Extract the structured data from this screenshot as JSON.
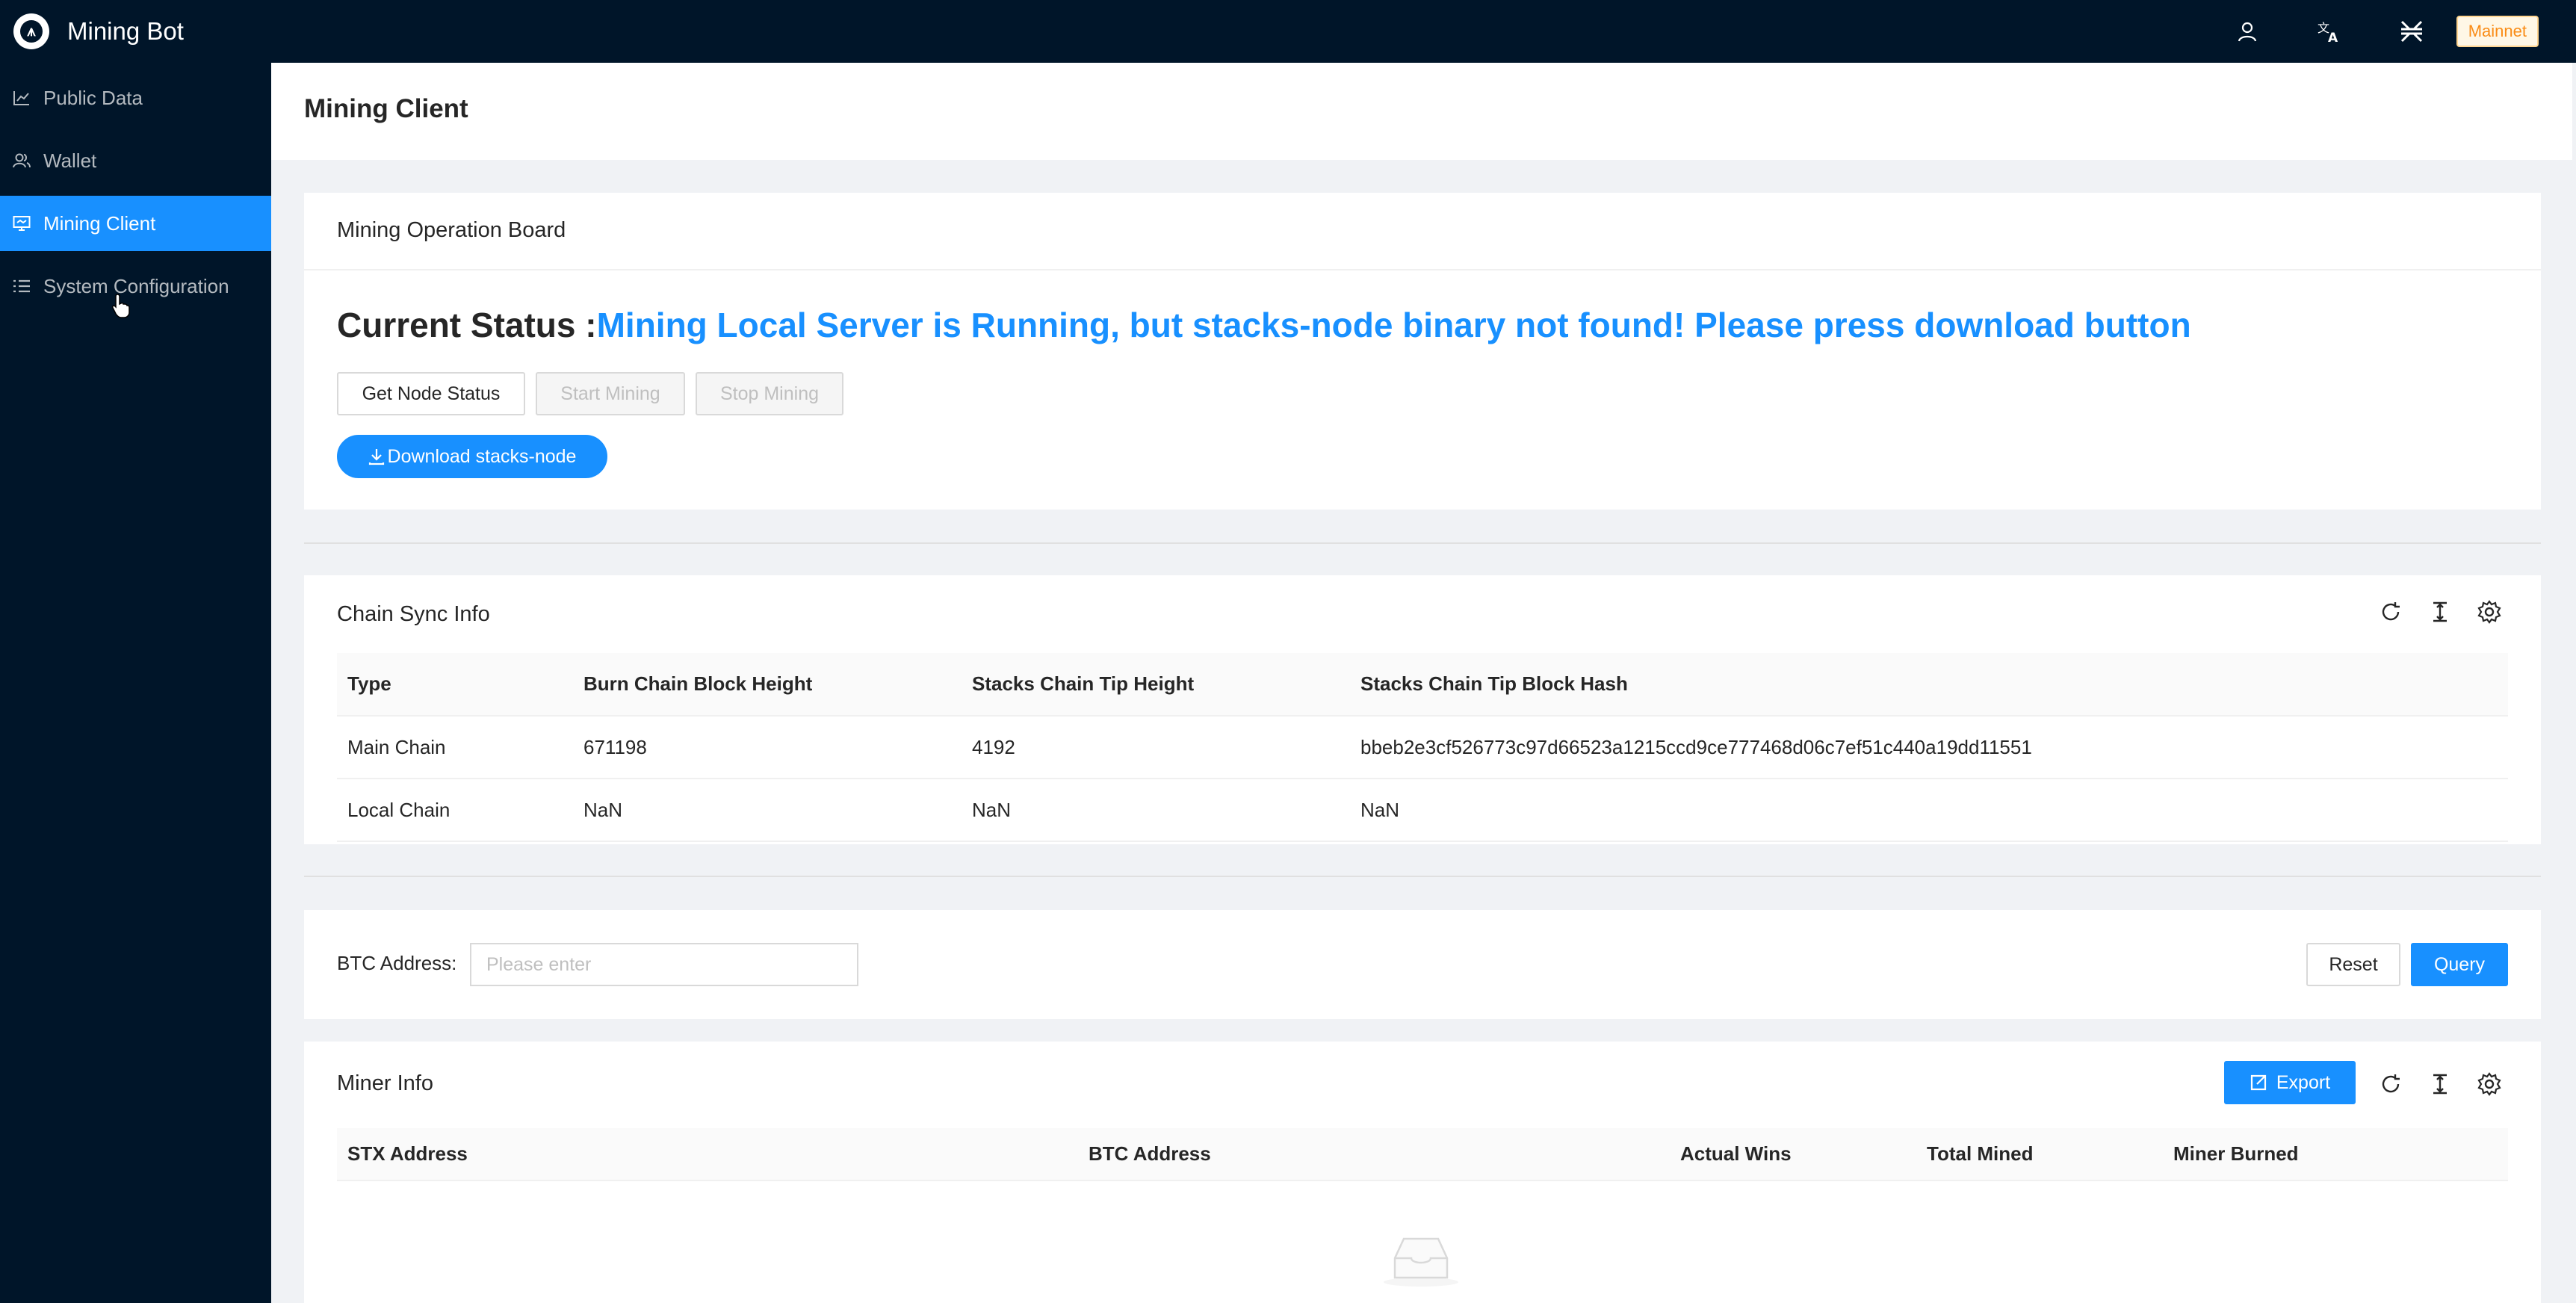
{
  "app": {
    "title": "Mining Bot",
    "network_badge": "Mainnet"
  },
  "sidebar": {
    "items": [
      {
        "label": "Public Data",
        "icon": "chart-line-icon"
      },
      {
        "label": "Wallet",
        "icon": "user-group-icon"
      },
      {
        "label": "Mining Client",
        "icon": "desktop-icon",
        "active": true
      },
      {
        "label": "System Configuration",
        "icon": "list-icon"
      }
    ]
  },
  "page": {
    "title": "Mining Client"
  },
  "board": {
    "title": "Mining Operation Board",
    "status_label": "Current Status :",
    "status_value": "Mining Local Server is Running, but stacks-node binary not found! Please press download button",
    "get_node_status": "Get Node Status",
    "start_mining": "Start Mining",
    "stop_mining": "Stop Mining",
    "download": "Download stacks-node"
  },
  "chain_sync": {
    "title": "Chain Sync Info",
    "columns": [
      "Type",
      "Burn Chain Block Height",
      "Stacks Chain Tip Height",
      "Stacks Chain Tip Block Hash"
    ],
    "rows": [
      [
        "Main Chain",
        "671198",
        "4192",
        "bbeb2e3cf526773c97d66523a1215ccd9ce777468d06c7ef51c440a19dd11551"
      ],
      [
        "Local Chain",
        "NaN",
        "NaN",
        "NaN"
      ]
    ]
  },
  "search": {
    "label": "BTC Address",
    "placeholder": "Please enter",
    "reset": "Reset",
    "query": "Query"
  },
  "miner": {
    "title": "Miner Info",
    "export": "Export",
    "columns": [
      "STX Address",
      "BTC Address",
      "Actual Wins",
      "Total Mined",
      "Miner Burned"
    ]
  },
  "colors": {
    "primary": "#1890ff",
    "sidebar_bg": "#001529",
    "status": "#1890ff"
  }
}
